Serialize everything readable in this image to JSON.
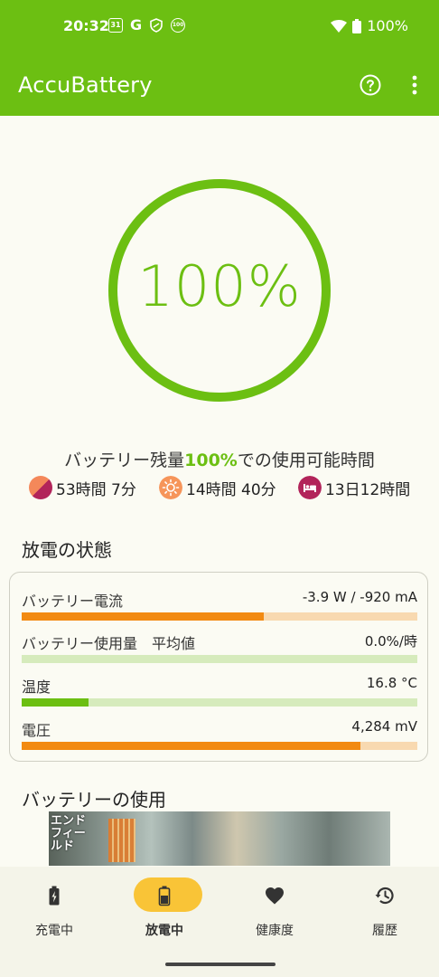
{
  "status_bar": {
    "time": "20:32",
    "calendar_icon_text": "31",
    "g_text": "G",
    "battery_badge_text": "100",
    "battery_percent": "100%"
  },
  "app_bar": {
    "title": "AccuBattery"
  },
  "gauge": {
    "percent_text": "100%",
    "level": 1.0,
    "color": "#6cbf12"
  },
  "estimate": {
    "prefix": "バッテリー残量",
    "highlight": "100%",
    "suffix": "での使用可能時間",
    "items": [
      {
        "icon": "screen-on-icon",
        "value": "53時間 7分"
      },
      {
        "icon": "sun-icon",
        "value": "14時間 40分"
      },
      {
        "icon": "sleep-bed-icon",
        "value": "13日12時間"
      }
    ]
  },
  "discharge_section": {
    "title": "放電の状態",
    "metrics": [
      {
        "label": "バッテリー電流",
        "value": "-3.9 W / -920 mA",
        "fill": 0.612,
        "fill_color": "#f28a12",
        "track_color": "#f8d9b0"
      },
      {
        "label": "バッテリー使用量　平均値",
        "value": "0.0%/時",
        "fill": 0.0,
        "fill_color": "#6cbf12",
        "track_color": "#d6ebbc"
      },
      {
        "label": "温度",
        "value": "16.8 °C",
        "fill": 0.17,
        "fill_color": "#6cbf12",
        "track_color": "#d6ebbc"
      },
      {
        "label": "電圧",
        "value": "4,284 mV",
        "fill": 0.857,
        "fill_color": "#f28a12",
        "track_color": "#f8d9b0"
      }
    ]
  },
  "usage_section": {
    "title": "バッテリーの使用"
  },
  "ad": {
    "logo_text": "エンドフィールド"
  },
  "bottom_nav": [
    {
      "label": "充電中",
      "active": false
    },
    {
      "label": "放電中",
      "active": true
    },
    {
      "label": "健康度",
      "active": false
    },
    {
      "label": "履歴",
      "active": false
    }
  ],
  "colors": {
    "accent": "#6cbf12",
    "orange": "#f28a12",
    "nav_active": "#f9c437",
    "background": "#fbfbf3"
  }
}
